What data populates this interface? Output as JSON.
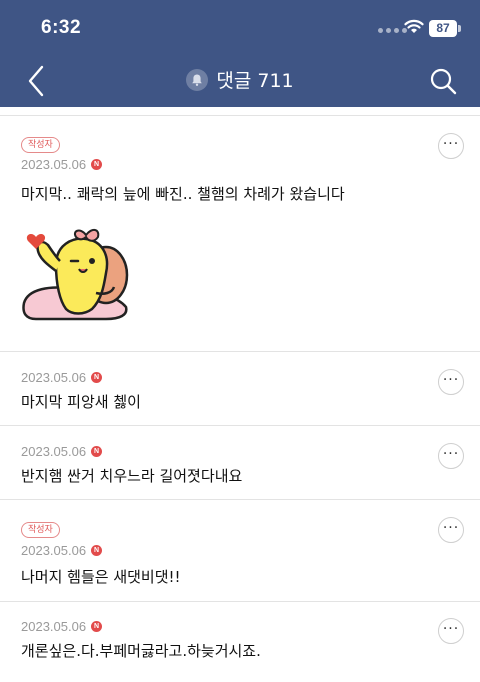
{
  "status_bar": {
    "time": "6:32",
    "battery": "87"
  },
  "header": {
    "title": "댓글 711"
  },
  "comments": [
    {
      "author_badge": "작성자",
      "date": "2023.05.06",
      "new_badge": "N",
      "text": "마지막.. 쾌락의 늪에 빠진.. 챌햄의 차례가 왔습니다",
      "sticker": "waving-yellow-character-sticker"
    },
    {
      "date": "2023.05.06",
      "new_badge": "N",
      "text": "마지막 피앙새 쳃이"
    },
    {
      "date": "2023.05.06",
      "new_badge": "N",
      "text": "반지햄 싼거 치우느라 길어졋다내요"
    },
    {
      "author_badge": "작성자",
      "date": "2023.05.06",
      "new_badge": "N",
      "text": "나머지 헴들은 새댓비댓!!"
    },
    {
      "date": "2023.05.06",
      "new_badge": "N",
      "text": "개론싶은.다.부페머긇라고.하늦거시죠."
    }
  ],
  "colors": {
    "header_bg": "#3f5585",
    "badge_red": "#e24b4b"
  }
}
